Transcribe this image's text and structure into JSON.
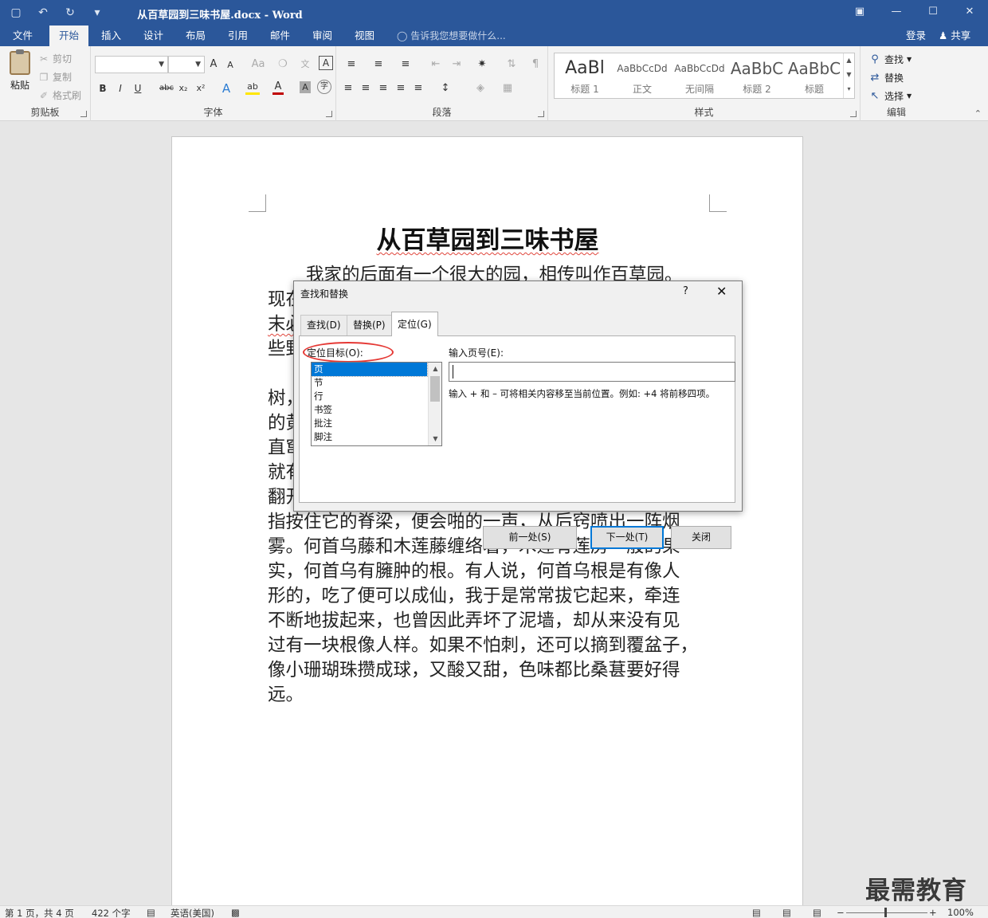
{
  "window": {
    "title": "从百草园到三味书屋.docx - Word",
    "qat_icons": [
      "save-icon",
      "undo-icon",
      "redo-icon",
      "customize-qat-icon"
    ],
    "controls": [
      "ribbon-display-icon",
      "minimize-icon",
      "maximize-icon",
      "close-icon"
    ]
  },
  "tabs": [
    {
      "label": "文件"
    },
    {
      "label": "开始"
    },
    {
      "label": "插入"
    },
    {
      "label": "设计"
    },
    {
      "label": "布局"
    },
    {
      "label": "引用"
    },
    {
      "label": "邮件"
    },
    {
      "label": "审阅"
    },
    {
      "label": "视图"
    }
  ],
  "tellme": "告诉我您想要做什么...",
  "login": "登录",
  "share": "共享",
  "ribbon": {
    "clipboard": {
      "label": "剪贴板",
      "paste": "粘贴",
      "cut": "剪切",
      "copy": "复制",
      "format_painter": "格式刷"
    },
    "font": {
      "label": "字体",
      "name": "",
      "size": "",
      "bold": "B",
      "italic": "I",
      "underline": "U",
      "strike": "abc",
      "sub": "x₂",
      "sup": "x²",
      "grow": "A",
      "shrink": "A",
      "case": "Aa",
      "text_effect": "A",
      "font_color": "A",
      "char_shade": "A",
      "enclose": "字",
      "phonetic": "文",
      "border_char": "A"
    },
    "paragraph": {
      "label": "段落"
    },
    "styles": {
      "label": "样式",
      "items": [
        {
          "sample": "AaBl",
          "name": "标题 1"
        },
        {
          "sample": "AaBbCcDd",
          "name": "正文"
        },
        {
          "sample": "AaBbCcDd",
          "name": "无间隔"
        },
        {
          "sample": "AaBbC",
          "name": "标题 2"
        },
        {
          "sample": "AaBbC",
          "name": "标题"
        }
      ]
    },
    "editing": {
      "label": "编辑",
      "find": "查找",
      "replace": "替换",
      "select": "选择"
    }
  },
  "document": {
    "title": "从百草园到三味书屋",
    "lines": [
      "我家的后面有一个很大的园，相传叫作百草园。",
      "现在",
      "末必",
      "些野",
      "树，",
      "的黄",
      "直窜",
      "就有",
      "翻开",
      "指按住它的脊梁，便会啪的一声，从后窍喷出一阵烟",
      "雾。何首乌藤和木莲藤缠络着，木莲有莲房一般的果",
      "实，何首乌有臃肿的根。有人说，何首乌根是有像人",
      "形的，吃了便可以成仙，我于是常常拔它起来，牵连",
      "不断地拔起来，也曾因此弄坏了泥墙，却从来没有见",
      "过有一块根像人样。如果不怕刺，还可以摘到覆盆子，",
      "像小珊瑚珠攒成球，又酸又甜，色味都比桑葚要好得",
      "远。"
    ]
  },
  "dialog": {
    "title": "查找和替换",
    "help": "?",
    "close": "✕",
    "tabs": [
      "查找(D)",
      "替换(P)",
      "定位(G)"
    ],
    "target_label": "定位目标(O):",
    "targets": [
      "页",
      "节",
      "行",
      "书签",
      "批注",
      "脚注"
    ],
    "page_label": "输入页号(E):",
    "page_value": "",
    "hint": "输入 + 和 – 可将相关内容移至当前位置。例如: +4 将前移四项。",
    "prev_button": "前一处(S)",
    "next_button": "下一处(T)",
    "close_button": "关闭"
  },
  "status": {
    "page": "第 1 页，共 4 页",
    "words": "422 个字",
    "language": "英语(美国)",
    "zoom": "100%",
    "zoom_level": 1.0
  },
  "watermark": "最需教育"
}
